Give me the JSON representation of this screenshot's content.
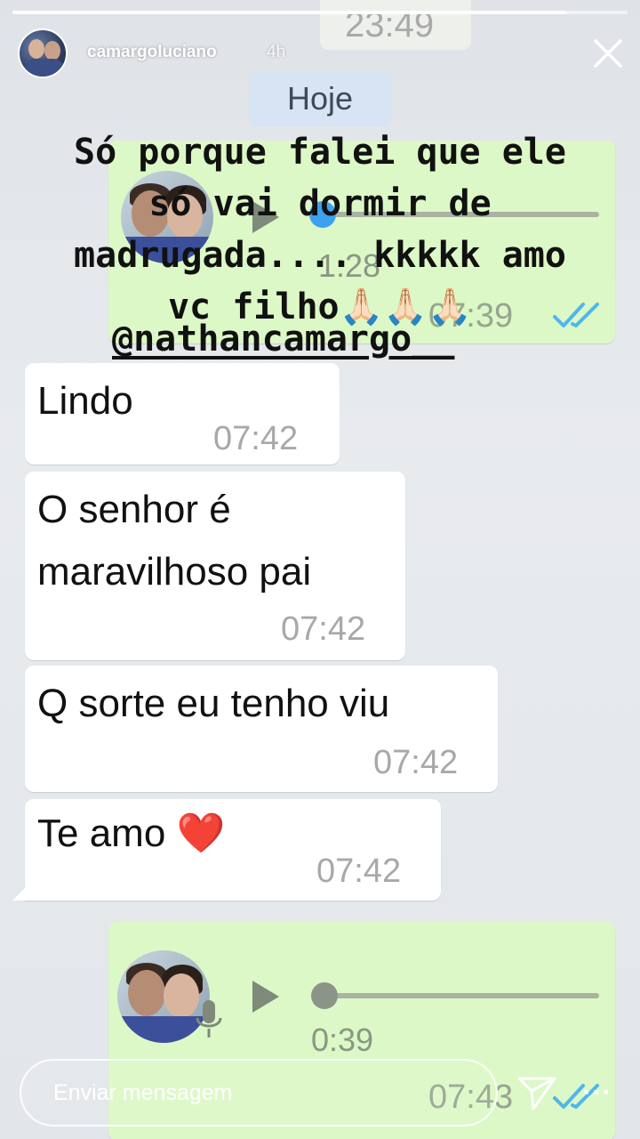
{
  "story": {
    "username": "camargoluciano",
    "time_ago": "4h",
    "progress_fraction": 0.9
  },
  "chat": {
    "top_partial_time": "23:49",
    "date_label": "Hoje",
    "voice_message_1": {
      "duration": "1:28",
      "time": "07:39",
      "status_icon": "double-check-blue"
    },
    "messages": [
      {
        "text": "Lindo",
        "time": "07:42"
      },
      {
        "text": "O senhor é maravilhoso pai",
        "line1": "O senhor é",
        "line2": "maravilhoso pai",
        "time": "07:42"
      },
      {
        "text": "Q sorte eu tenho viu",
        "time": "07:42"
      },
      {
        "text": "Te amo ❤️",
        "time": "07:42"
      }
    ],
    "voice_message_2": {
      "duration": "0:39",
      "time": "07:43",
      "status_icon": "double-check-blue"
    }
  },
  "caption": {
    "lines": [
      "Só porque falei que ele",
      "só vai dormir de",
      "madrugada.... kkkkk amo",
      "vc filho🙏🏻🙏🏻🙏🏻"
    ],
    "mention": "@nathancamargo__"
  },
  "reply": {
    "placeholder": "Enviar mensagem"
  },
  "icons": [
    "close-icon",
    "play-icon",
    "mic-icon",
    "send-icon",
    "more-icon",
    "double-check-icon"
  ],
  "colors": {
    "incoming_bubble": "#ffffff",
    "outgoing_bubble": "#dcf8c6",
    "read_ticks": "#4fb6ec",
    "date_chip": "#d6e4f3",
    "audio_knob_active": "#3ba1f0"
  }
}
